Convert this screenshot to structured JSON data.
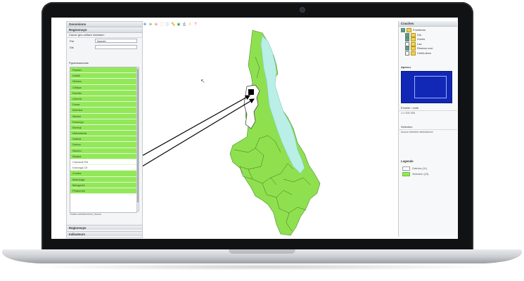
{
  "left_panel": {
    "title": "Geovisions",
    "subtitle": "Regionnaye",
    "selector": "Cauze geo-unitare ntamane:",
    "field1_label": "Pal",
    "field1_value": "Nuevirt",
    "field2_label": "Dis",
    "list_title": "Pgranisanorsbe",
    "items": [
      {
        "label": "Pander",
        "selected": true
      },
      {
        "label": "Kabbil",
        "selected": true
      },
      {
        "label": "Nkhata",
        "selected": true
      },
      {
        "label": "Chitipa",
        "selected": true
      },
      {
        "label": "Rumfia",
        "selected": true
      },
      {
        "label": "Likoma",
        "selected": true
      },
      {
        "label": "Dowa",
        "selected": true
      },
      {
        "label": "Mzimba",
        "selected": true
      },
      {
        "label": "Ntchisi",
        "selected": true
      },
      {
        "label": "Kasungu",
        "selected": true
      },
      {
        "label": "Mchinji",
        "selected": true
      },
      {
        "label": "Nkhotakota",
        "selected": true
      },
      {
        "label": "Salima",
        "selected": true
      },
      {
        "label": "Dedza",
        "selected": true
      },
      {
        "label": "Ntcheu",
        "selected": true
      },
      {
        "label": "Balaka",
        "selected": true
      },
      {
        "label": "Cascade Rd",
        "selected": false
      },
      {
        "label": "Karonga Cit",
        "selected": false
      },
      {
        "label": "Zomba",
        "selected": true
      },
      {
        "label": "Machinga",
        "selected": true
      },
      {
        "label": "Mangochi",
        "selected": true
      },
      {
        "label": "Phalombe",
        "selected": true
      }
    ],
    "footer": "Toutes selectionnees | aucun",
    "section2": "Regionnaye",
    "section3": "Indicateurs"
  },
  "toolbar": {
    "icons": [
      "pan-icon",
      "zoom-in-icon",
      "zoom-out-icon",
      "full-extent-icon",
      "info-icon",
      "measure-icon",
      "select-icon",
      "print-icon",
      "export-icon",
      "help-icon"
    ]
  },
  "right_panel": {
    "title": "Couches",
    "layers": [
      {
        "label": "Frontieres",
        "checked": true
      },
      {
        "label": "Dis",
        "checked": true
      },
      {
        "label": "Zones",
        "checked": true
      },
      {
        "label": "Lac",
        "checked": false
      },
      {
        "label": "Reseau rout.",
        "checked": true
      },
      {
        "label": "Chefs-lieux",
        "checked": false
      }
    ],
    "overview_title": "Apercu",
    "scale_title": "Echelle / unite",
    "scale_value": "1:1 000 000",
    "attr_title": "Selection",
    "attr_value": "Aucun element selectionne",
    "legend_title": "Legende",
    "legend": [
      {
        "label": "Districts (11)",
        "swatch": "empty"
      },
      {
        "label": "Selection (23)",
        "swatch": "green"
      }
    ]
  },
  "map": {
    "land_color": "#8fe04f",
    "lake_color": "#b9efe6",
    "selected_color": "#ffffff",
    "arrow_color": "#000000"
  }
}
